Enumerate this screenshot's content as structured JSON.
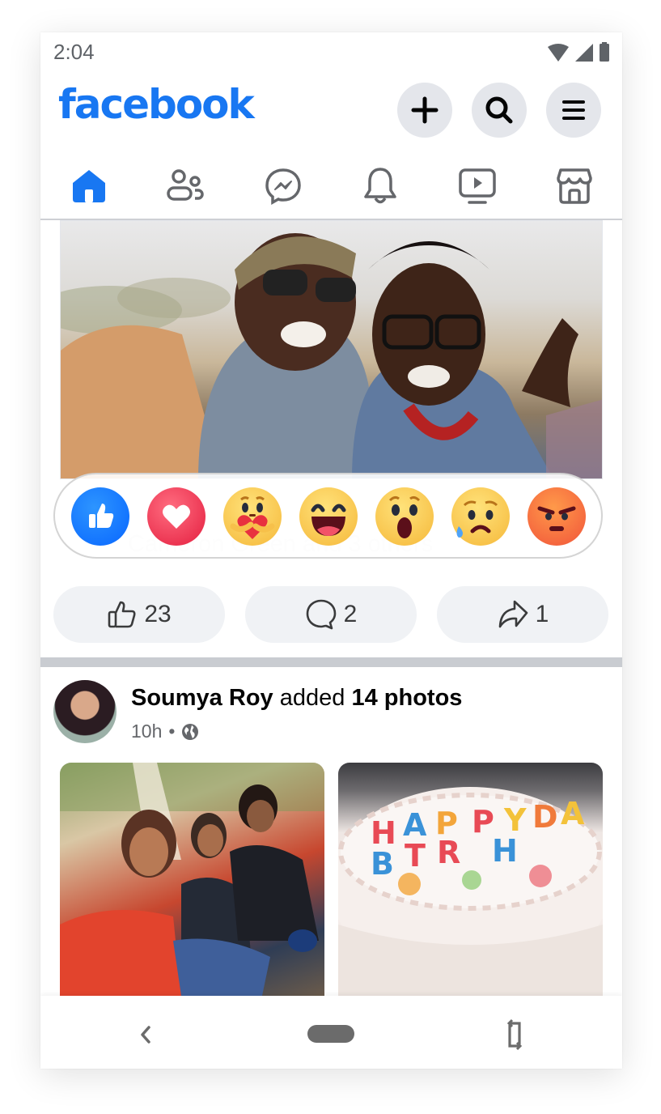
{
  "status_bar": {
    "time": "2:04",
    "icons": [
      "wifi-icon",
      "cellular-signal-icon",
      "battery-icon"
    ]
  },
  "header": {
    "logo": "facebook",
    "brand_color": "#1877f2",
    "buttons": [
      {
        "name": "create",
        "icon": "plus-icon"
      },
      {
        "name": "search",
        "icon": "search-icon"
      },
      {
        "name": "menu",
        "icon": "menu-icon"
      }
    ]
  },
  "tabs": [
    {
      "name": "home",
      "icon": "home-icon",
      "active": true
    },
    {
      "name": "friends",
      "icon": "friends-icon",
      "active": false
    },
    {
      "name": "messenger",
      "icon": "messenger-icon",
      "active": false
    },
    {
      "name": "notifications",
      "icon": "bell-icon",
      "active": false
    },
    {
      "name": "watch",
      "icon": "video-icon",
      "active": false
    },
    {
      "name": "marketplace",
      "icon": "marketplace-icon",
      "active": false
    }
  ],
  "post1": {
    "photo_alt": "Two friends taking a selfie outdoors",
    "reactions": [
      "Like",
      "Love",
      "Care",
      "Haha",
      "Wow",
      "Sad",
      "Angry"
    ],
    "reacted_by_text": "Cameron Green and 3 others",
    "actions": {
      "like_count": "23",
      "comment_count": "2",
      "share_count": "1"
    }
  },
  "post2": {
    "author": "Soumya Roy",
    "action_text": "added",
    "object_text": "14 photos",
    "time": "10h",
    "separator": "•",
    "privacy_icon": "globe-icon",
    "photos": [
      {
        "alt": "Group of friends taking a selfie"
      },
      {
        "alt": "Birthday cake with Happy Birthday candles"
      }
    ],
    "cake_text": "HAPPY BIRTHDAY"
  },
  "nav_bar": {
    "buttons": [
      "back",
      "home",
      "rotate"
    ]
  }
}
